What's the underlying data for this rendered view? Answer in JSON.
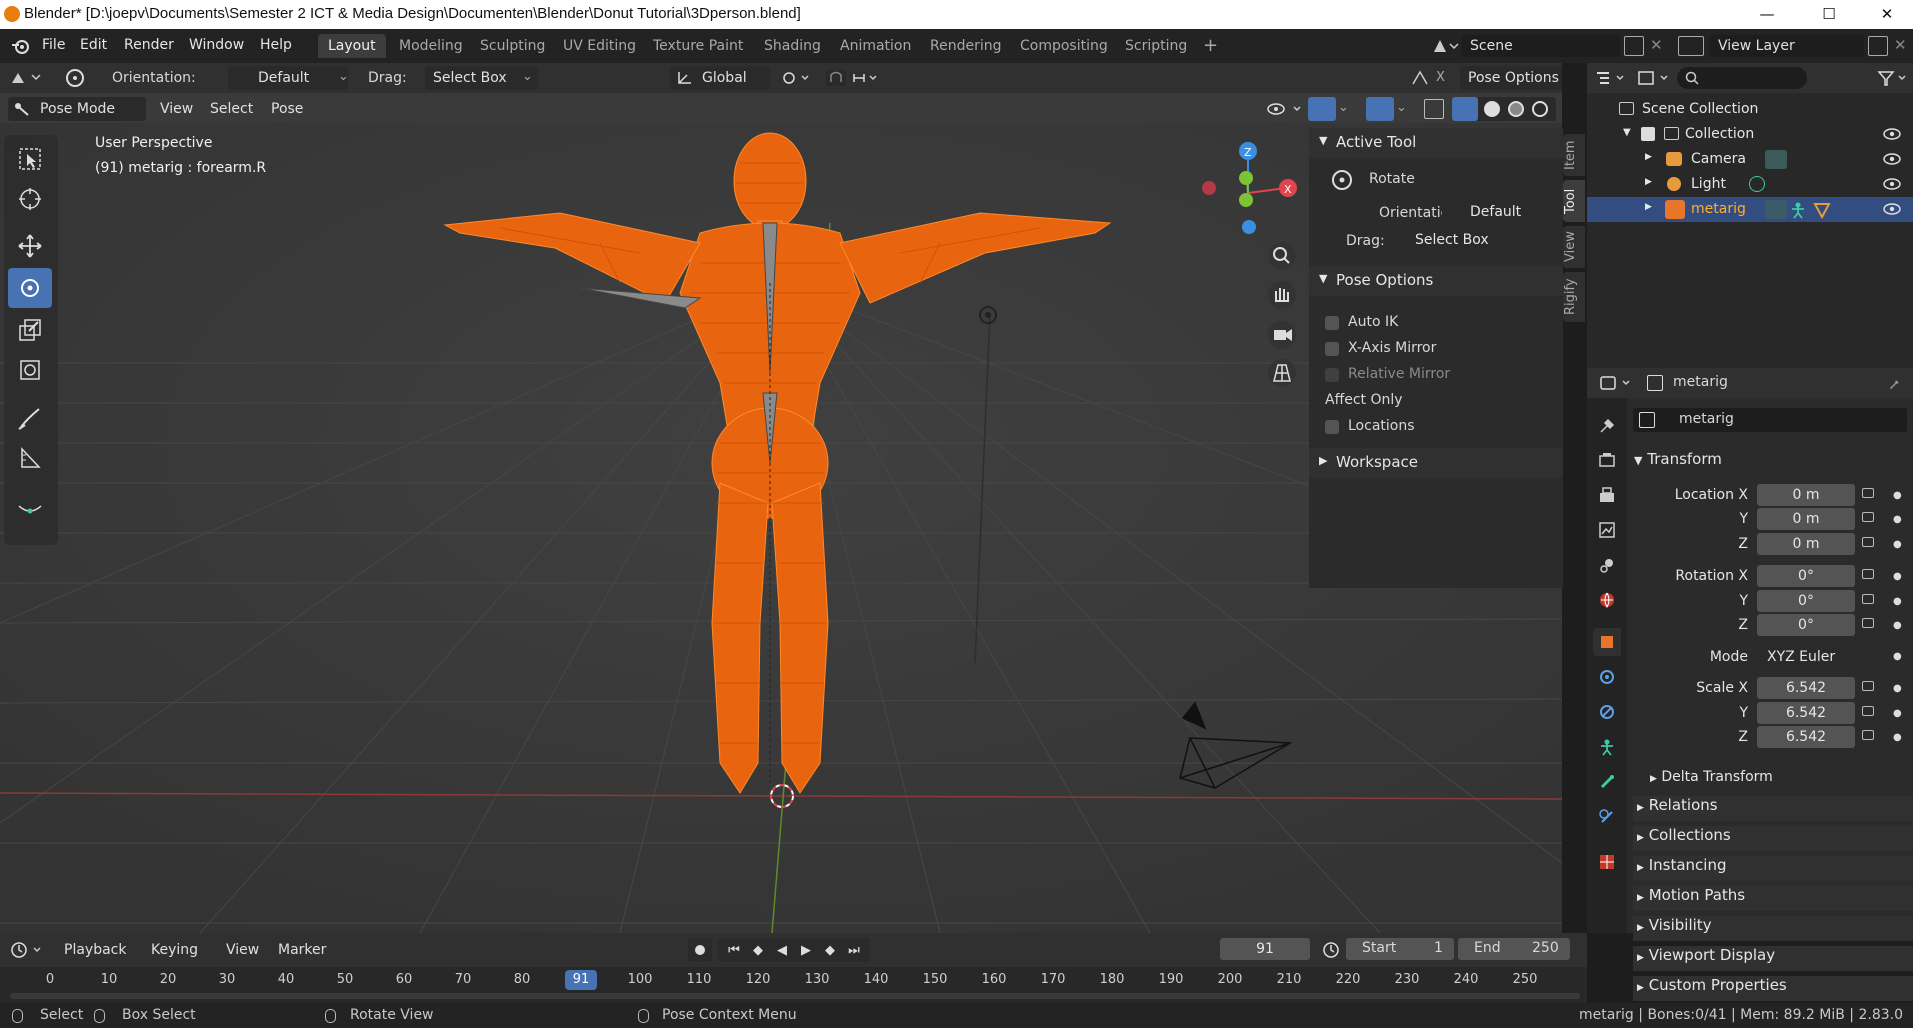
{
  "window": {
    "title": "Blender* [D:\\joepv\\Documents\\Semester 2 ICT & Media Design\\Documenten\\Blender\\Donut Tutorial\\3Dperson.blend]",
    "minimize": "—",
    "maximize": "☐",
    "close": "✕"
  },
  "menu": [
    "File",
    "Edit",
    "Render",
    "Window",
    "Help"
  ],
  "workspaces": {
    "active": "Layout",
    "tabs": [
      "Layout",
      "Modeling",
      "Sculpting",
      "UV Editing",
      "Texture Paint",
      "Shading",
      "Animation",
      "Rendering",
      "Compositing",
      "Scripting"
    ],
    "add": "+"
  },
  "scene": {
    "name": "Scene",
    "view_layer": "View Layer"
  },
  "tool_header": {
    "orientation_label": "Orientation:",
    "orientation_value": "Default",
    "drag_label": "Drag:",
    "drag_value": "Select Box",
    "transform_orientation": "Global",
    "pose_options": "Pose Options"
  },
  "viewport_header": {
    "mode": "Pose Mode",
    "menus": [
      "View",
      "Select",
      "Pose"
    ]
  },
  "viewport": {
    "perspective": "User Perspective",
    "active_info": "(91) metarig : forearm.R"
  },
  "npanel": {
    "active_tool_title": "Active Tool",
    "tool_name": "Rotate",
    "orientation_label": "Orientation",
    "orientation_value": "Default",
    "drag_label": "Drag:",
    "drag_value": "Select Box",
    "pose_options_title": "Pose Options",
    "auto_ik": "Auto IK",
    "x_axis_mirror": "X-Axis Mirror",
    "relative_mirror": "Relative Mirror",
    "affect_only": "Affect Only",
    "locations": "Locations",
    "workspace_title": "Workspace",
    "tabs": [
      "Item",
      "Tool",
      "View",
      "Rigify"
    ]
  },
  "outliner": {
    "scene_collection": "Scene Collection",
    "collection": "Collection",
    "items": [
      {
        "name": "Camera",
        "selected": false
      },
      {
        "name": "Light",
        "selected": false
      },
      {
        "name": "metarig",
        "selected": true
      }
    ]
  },
  "properties": {
    "object_name": "metarig",
    "data_name": "metarig",
    "transform_title": "Transform",
    "location_x_label": "Location X",
    "y_label": "Y",
    "z_label": "Z",
    "location": [
      "0 m",
      "0 m",
      "0 m"
    ],
    "rotation_x_label": "Rotation X",
    "rotation": [
      "0°",
      "0°",
      "0°"
    ],
    "mode_label": "Mode",
    "mode_value": "XYZ Euler",
    "scale_x_label": "Scale X",
    "scale": [
      "6.542",
      "6.542",
      "6.542"
    ],
    "delta_transform": "Delta Transform",
    "sections": [
      "Relations",
      "Collections",
      "Instancing",
      "Motion Paths",
      "Visibility",
      "Viewport Display",
      "Custom Properties"
    ]
  },
  "timeline": {
    "menus": [
      "Playback",
      "Keying",
      "View",
      "Marker"
    ],
    "current_frame": "91",
    "start_label": "Start",
    "start_value": "1",
    "end_label": "End",
    "end_value": "250",
    "ticks": [
      "0",
      "10",
      "20",
      "30",
      "40",
      "50",
      "60",
      "70",
      "80",
      "91",
      "100",
      "110",
      "120",
      "130",
      "140",
      "150",
      "160",
      "170",
      "180",
      "190",
      "200",
      "210",
      "220",
      "230",
      "240",
      "250"
    ]
  },
  "statusbar": {
    "select": "Select",
    "box_select": "Box Select",
    "rotate_view": "Rotate View",
    "context_menu": "Pose Context Menu",
    "stats": "metarig | Bones:0/41 | Mem: 89.2 MiB | 2.83.0"
  },
  "colors": {
    "accent": "#4772b3",
    "wire": "#ff6a00",
    "selected_text": "#ffaf29",
    "x_axis": "#e0454f",
    "y_axis": "#7ec336",
    "z_axis": "#3b8fe0"
  }
}
